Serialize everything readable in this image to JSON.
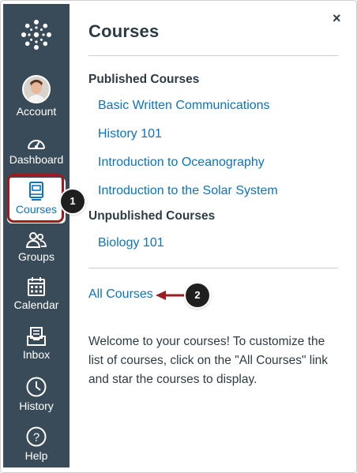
{
  "nav": {
    "items": [
      {
        "label": "Account"
      },
      {
        "label": "Dashboard"
      },
      {
        "label": "Courses"
      },
      {
        "label": "Groups"
      },
      {
        "label": "Calendar"
      },
      {
        "label": "Inbox"
      },
      {
        "label": "History"
      },
      {
        "label": "Help"
      }
    ]
  },
  "panel": {
    "title": "Courses",
    "close_label": "×",
    "published_heading": "Published Courses",
    "published": [
      {
        "label": "Basic Written Communications"
      },
      {
        "label": "History 101"
      },
      {
        "label": "Introduction to Oceanography"
      },
      {
        "label": "Introduction to the Solar System"
      }
    ],
    "unpublished_heading": "Unpublished Courses",
    "unpublished": [
      {
        "label": "Biology 101"
      }
    ],
    "all_courses_label": "All Courses",
    "welcome_text": "Welcome to your courses! To customize the list of courses, click on the \"All Courses\" link and star the courses to display."
  },
  "callouts": [
    "1",
    "2"
  ],
  "colors": {
    "nav_bg": "#394b58",
    "link": "#0b74bd",
    "highlight": "#9b1d20",
    "text": "#2d3b45"
  }
}
